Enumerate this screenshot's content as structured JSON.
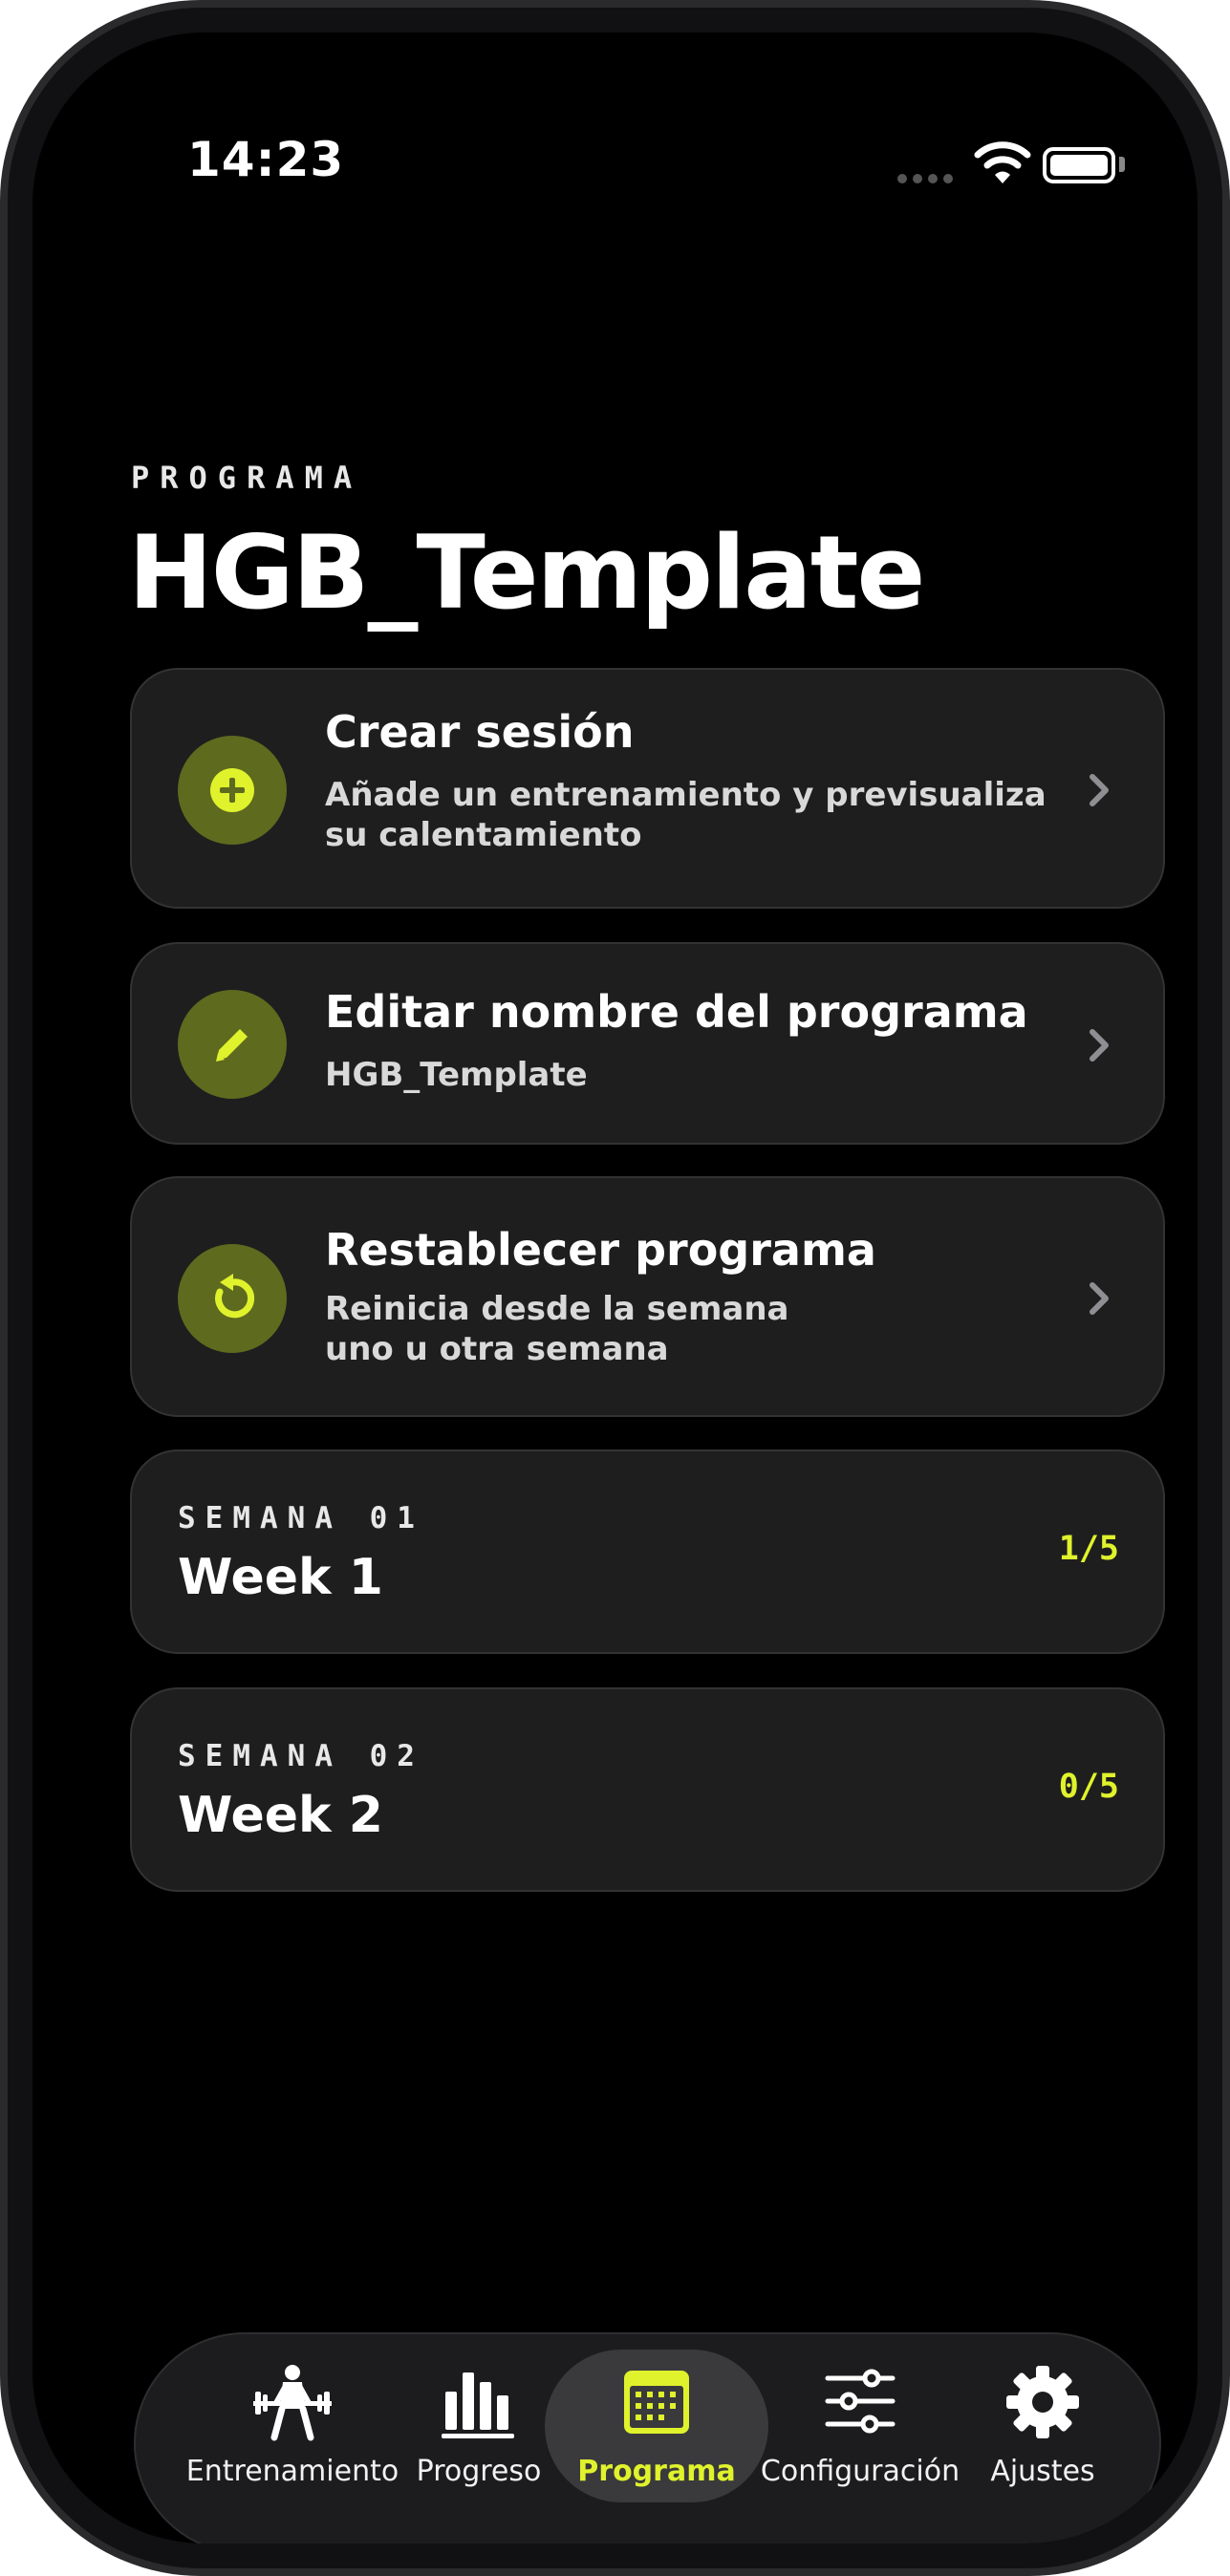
{
  "status_bar": {
    "time": "14:23"
  },
  "header": {
    "eyebrow": "PROGRAMA",
    "title": "HGB_Template"
  },
  "actions": [
    {
      "title": "Crear sesión",
      "subtitle": "Añade un entrenamiento y previsualiza su calentamiento",
      "icon": "plus-circle-icon"
    },
    {
      "title": "Editar nombre del programa",
      "subtitle": "HGB_Template",
      "icon": "pencil-icon"
    },
    {
      "title": "Restablecer programa",
      "subtitle": "Reinicia desde la semana uno u otra semana",
      "icon": "reset-icon"
    }
  ],
  "weeks": [
    {
      "label": "SEMANA 01",
      "title": "Week 1",
      "count": "1/5"
    },
    {
      "label": "SEMANA 02",
      "title": "Week 2",
      "count": "0/5"
    }
  ],
  "tabbar": {
    "tabs": [
      {
        "label": "Entrenamiento",
        "icon": "weightlifter-icon"
      },
      {
        "label": "Progreso",
        "icon": "bar-chart-icon"
      },
      {
        "label": "Programa",
        "icon": "calendar-icon",
        "active": true
      },
      {
        "label": "Configuración",
        "icon": "sliders-icon"
      },
      {
        "label": "Ajustes",
        "icon": "gear-icon"
      }
    ]
  },
  "colors": {
    "accent": "#dff22c",
    "icon_bg": "#5e6a1e",
    "card_bg": "#1e1e1e",
    "background": "#000000"
  }
}
